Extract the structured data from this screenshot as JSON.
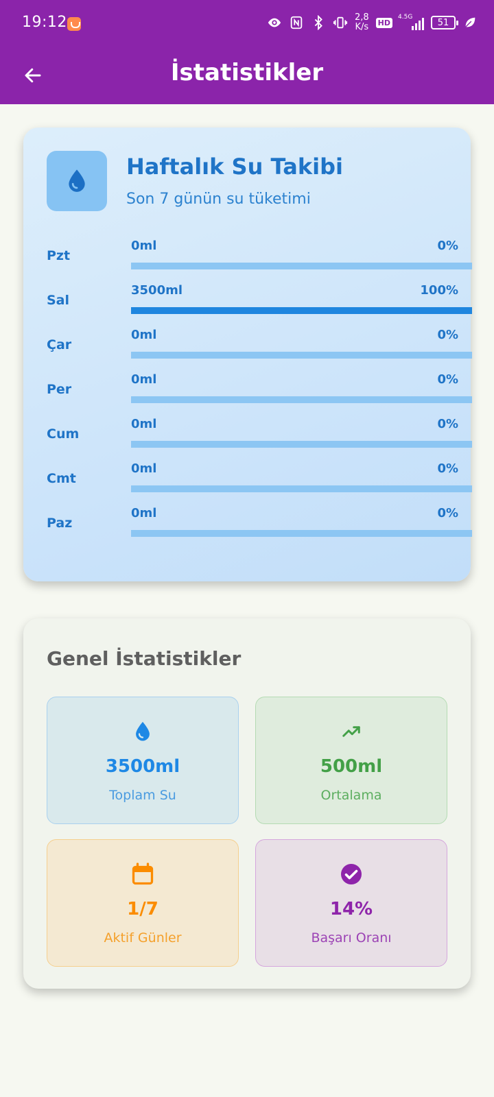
{
  "status_bar": {
    "time": "19:12",
    "speed_value": "2,8",
    "speed_unit": "K/s",
    "hd": "HD",
    "network": "4.5G",
    "battery": "51"
  },
  "app_bar": {
    "title": "İstatistikler"
  },
  "weekly": {
    "title": "Haftalık Su Takibi",
    "subtitle": "Son 7 günün su tüketimi",
    "days": [
      {
        "name": "Pzt",
        "amount": "0ml",
        "percent_label": "0%",
        "percent": 0
      },
      {
        "name": "Sal",
        "amount": "3500ml",
        "percent_label": "100%",
        "percent": 100
      },
      {
        "name": "Çar",
        "amount": "0ml",
        "percent_label": "0%",
        "percent": 0
      },
      {
        "name": "Per",
        "amount": "0ml",
        "percent_label": "0%",
        "percent": 0
      },
      {
        "name": "Cum",
        "amount": "0ml",
        "percent_label": "0%",
        "percent": 0
      },
      {
        "name": "Cmt",
        "amount": "0ml",
        "percent_label": "0%",
        "percent": 0
      },
      {
        "name": "Paz",
        "amount": "0ml",
        "percent_label": "0%",
        "percent": 0
      }
    ]
  },
  "general": {
    "title": "Genel İstatistikler",
    "stats": [
      {
        "icon": "water-drop-icon",
        "value": "3500ml",
        "label": "Toplam Su",
        "color": "#1e88e5",
        "label_color": "#4a9be0"
      },
      {
        "icon": "trending-up-icon",
        "value": "500ml",
        "label": "Ortalama",
        "color": "#43a047",
        "label_color": "#5cae5f"
      },
      {
        "icon": "calendar-icon",
        "value": "1/7",
        "label": "Aktif Günler",
        "color": "#fb8c00",
        "label_color": "#f4a02b"
      },
      {
        "icon": "check-circle-icon",
        "value": "14%",
        "label": "Başarı Oranı",
        "color": "#8e24aa",
        "label_color": "#9c43b5"
      }
    ]
  },
  "colors": {
    "primary": "#8b24aa",
    "blue": "#1f74c7",
    "bar_track": "#8cc6f3",
    "bar_fill": "#1f86df"
  }
}
